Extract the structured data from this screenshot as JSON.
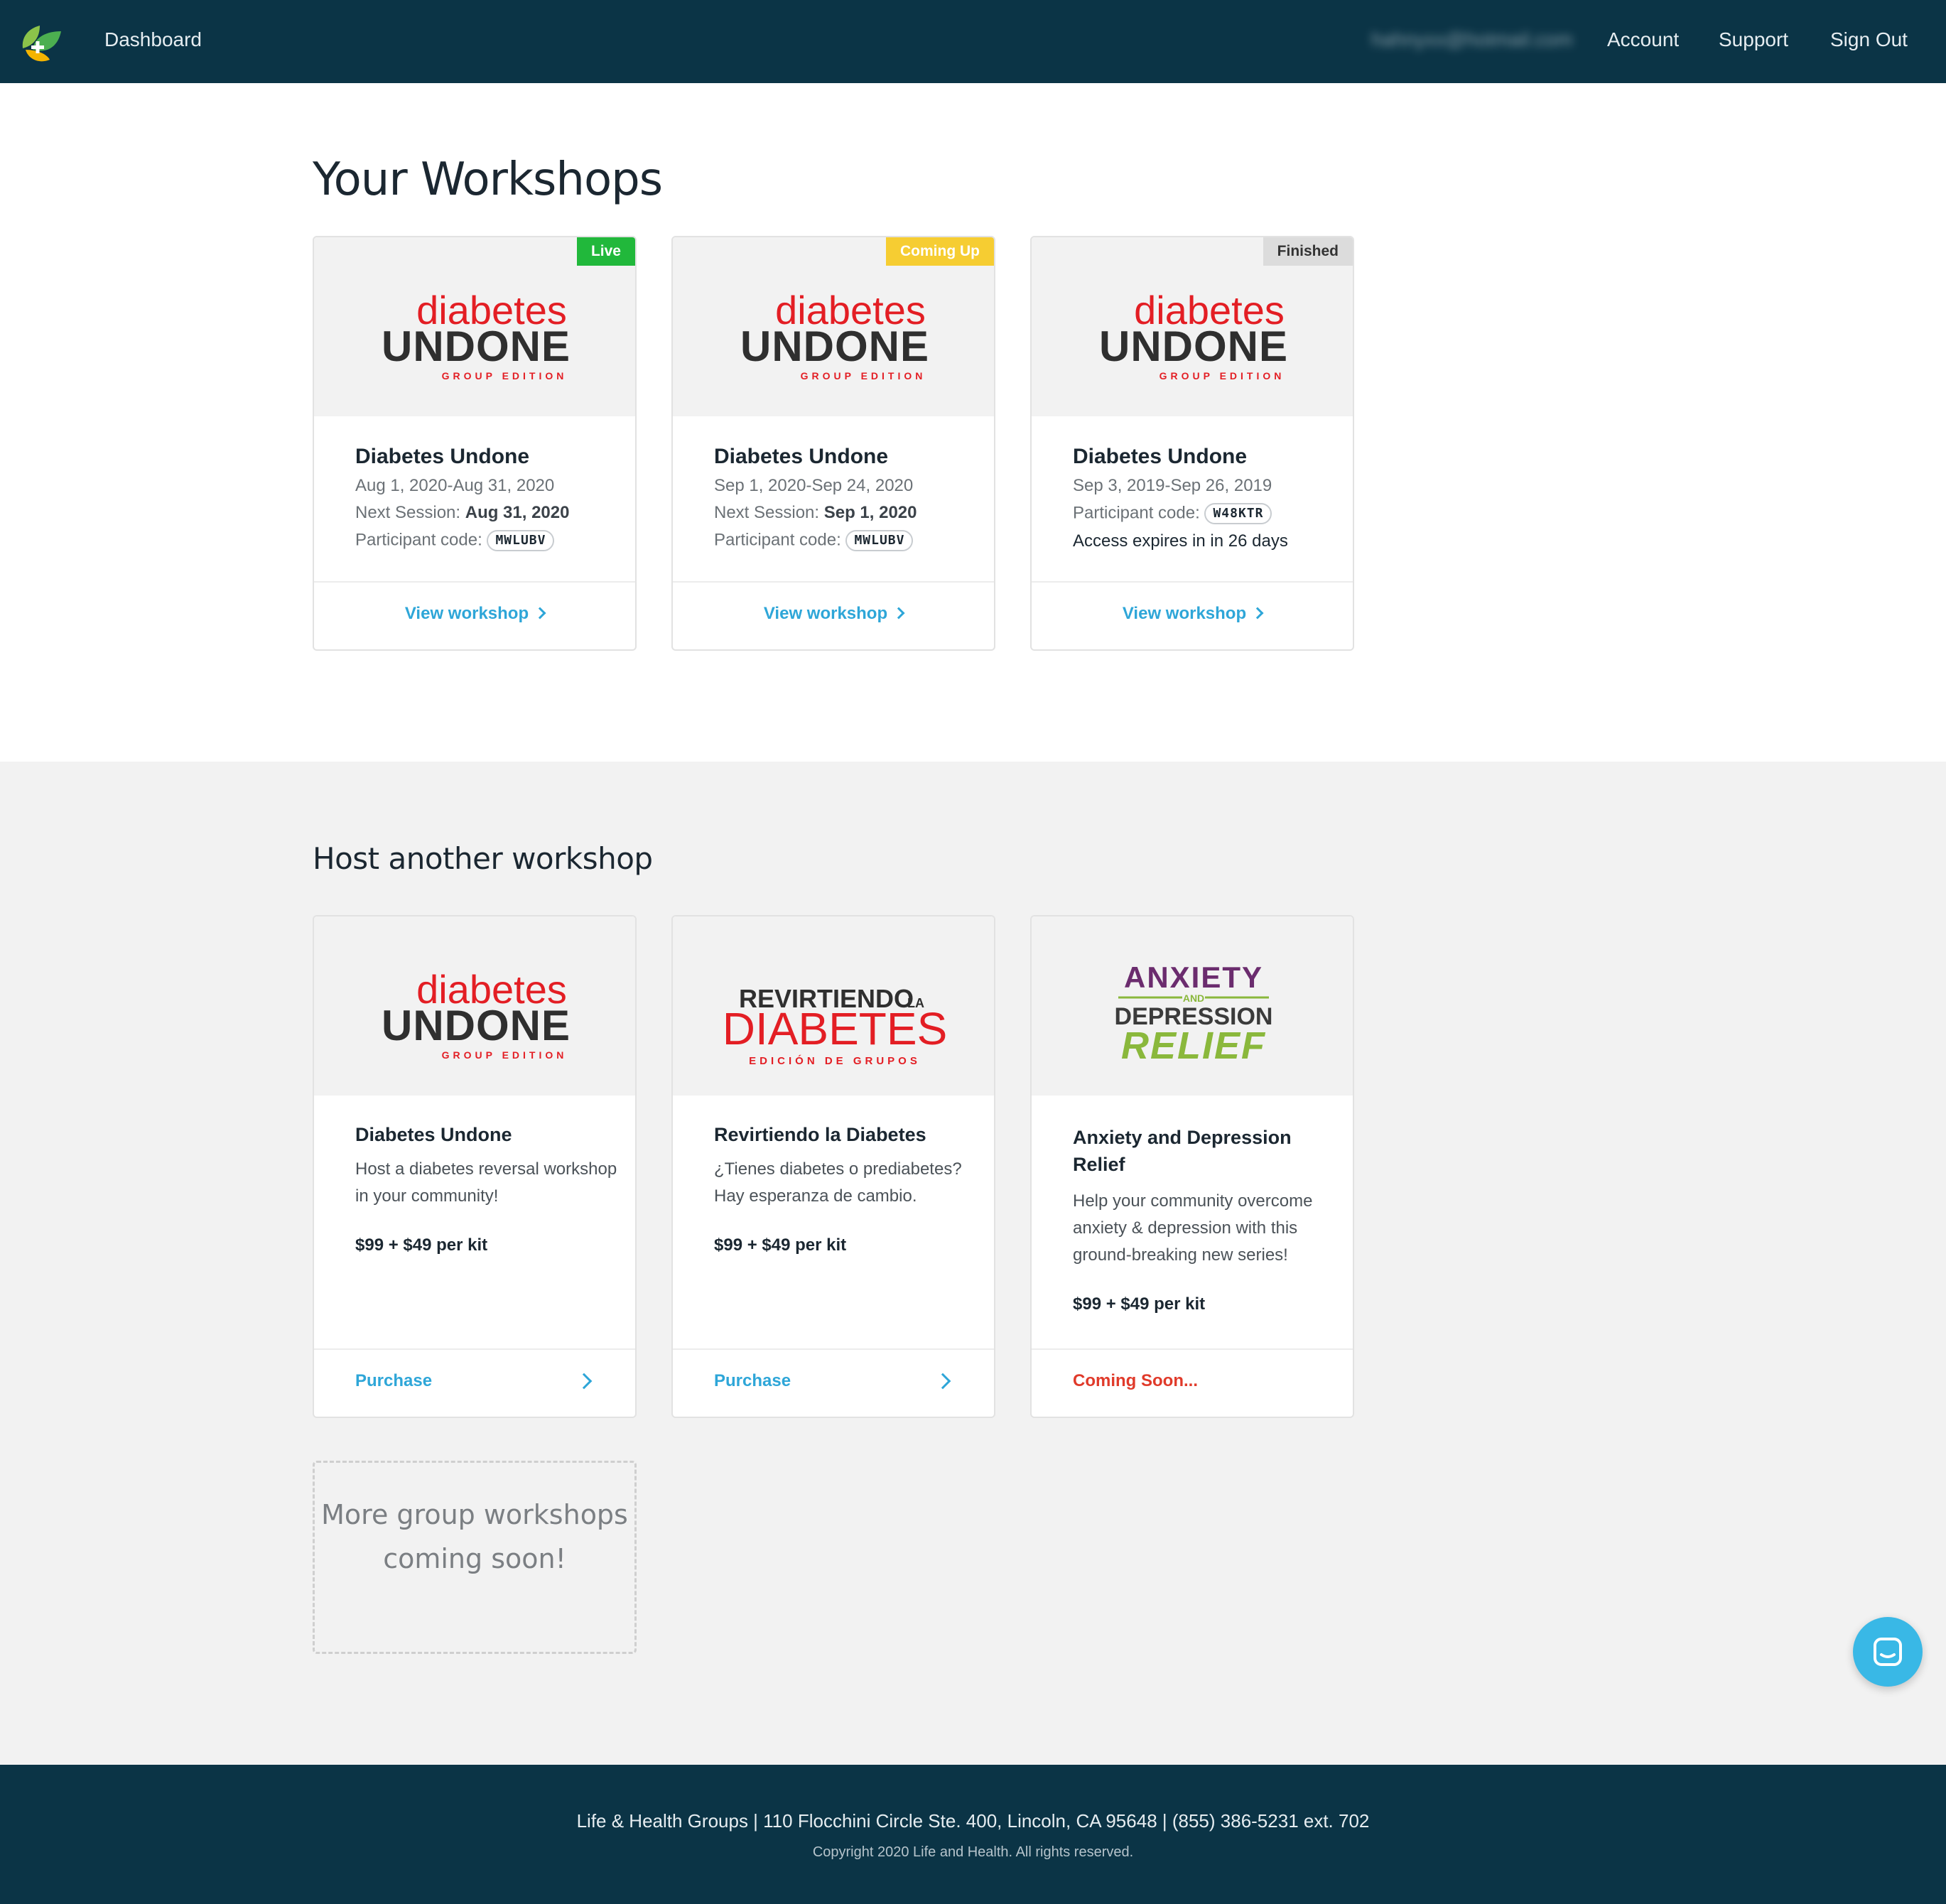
{
  "nav": {
    "dashboard": "Dashboard",
    "email": "hahnyxx@hotmail.com",
    "account": "Account",
    "support": "Support",
    "sign_out": "Sign Out"
  },
  "workshops": {
    "title": "Your Workshops",
    "cards": [
      {
        "status": "Live",
        "title": "Diabetes Undone",
        "dates": "Aug 1, 2020-Aug 31, 2020",
        "next_label": "Next Session: ",
        "next_value": "Aug 31, 2020",
        "code_label": "Participant code: ",
        "code": "MWLUBV",
        "link": "View workshop"
      },
      {
        "status": "Coming Up",
        "title": "Diabetes Undone",
        "dates": "Sep 1, 2020-Sep 24, 2020",
        "next_label": "Next Session: ",
        "next_value": "Sep 1, 2020",
        "code_label": "Participant code: ",
        "code": "MWLUBV",
        "link": "View workshop"
      },
      {
        "status": "Finished",
        "title": "Diabetes Undone",
        "dates": "Sep 3, 2019-Sep 26, 2019",
        "code_label": "Participant code: ",
        "code": "W48KTR",
        "expires": "Access expires in in 26 days",
        "link": "View workshop"
      }
    ]
  },
  "logos": {
    "diabetes_top": "diabetes",
    "diabetes_main": "UNDONE",
    "diabetes_sub": "GROUP EDITION",
    "revirtiendo_top": "REVIRTIENDO",
    "revirtiendo_la": "LA",
    "revirtiendo_main": "DIABETES",
    "revirtiendo_sub": "EDICIÓN DE GRUPOS",
    "anxiety_1": "ANXIETY",
    "anxiety_and": "AND",
    "anxiety_2": "DEPRESSION",
    "anxiety_3": "RELIEF"
  },
  "host": {
    "title": "Host another workshop",
    "cards": [
      {
        "title": "Diabetes Undone",
        "desc": "Host a diabetes reversal workshop in your community!",
        "price": "$99 + $49 per kit",
        "action": "Purchase"
      },
      {
        "title": "Revirtiendo la Diabetes",
        "desc": "¿Tienes diabetes o prediabetes? Hay esperanza de cambio.",
        "price": "$99 + $49 per kit",
        "action": "Purchase"
      },
      {
        "title": "Anxiety and Depression Relief",
        "desc": "Help your community overcome anxiety & depression with this ground-breaking new series!",
        "price": "$99 + $49 per kit",
        "action": "Coming Soon..."
      }
    ],
    "more": "More group workshops coming soon!"
  },
  "footer": {
    "address": "Life & Health Groups | 110 Flocchini Circle Ste. 400, Lincoln, CA 95648  |  (855) 386-5231 ext. 702",
    "copyright": "Copyright 2020 Life and Health. All rights reserved."
  },
  "colors": {
    "navy": "#0b3446",
    "link_blue": "#2ea6d8",
    "brand_red": "#e31e24",
    "live_green": "#21b83b",
    "coming_yellow": "#f6cd32",
    "anxiety_purple": "#6b2c6e",
    "relief_green": "#8ab83c"
  }
}
